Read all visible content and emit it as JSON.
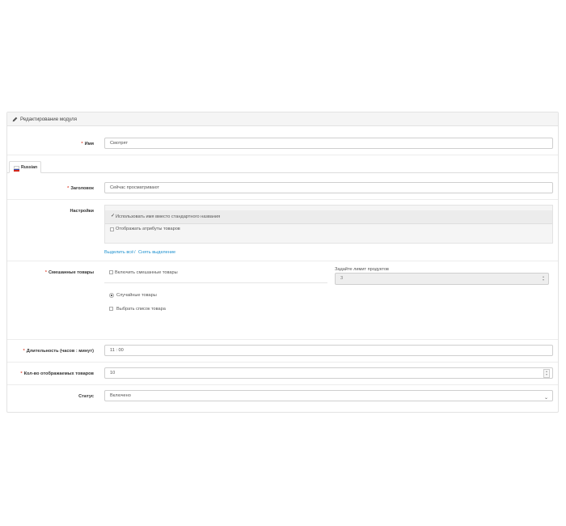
{
  "panel": {
    "title": "Редактирование модуля"
  },
  "fields": {
    "name": {
      "label": "Имя",
      "value": "Смотрят"
    },
    "language_tab": {
      "label": "Russian"
    },
    "heading": {
      "label": "Заголовок",
      "value": "Сейчас просматривают"
    },
    "settings": {
      "label": "Настройки",
      "options": [
        {
          "label": "Использовать имя вместо стандартного названия",
          "checked": true
        },
        {
          "label": "Отображать атрибуты товаров",
          "checked": false
        }
      ],
      "select_all": "Выделить всё",
      "separator": "/",
      "deselect": "Снять выделение"
    },
    "mixed": {
      "label": "Смешанные товары",
      "enable_label": "Включить смешанные товары",
      "limit_label": "Задайте лимит продуктов",
      "limit_value": "3",
      "radio_random": "Случайные товары",
      "radio_list": "Выбрать список товара"
    },
    "duration": {
      "label": "Длительность (часов : минут)",
      "value": "11 : 00"
    },
    "count": {
      "label": "Кол-во отображаемых товаров",
      "value": "10"
    },
    "status": {
      "label": "Статус",
      "value": "Включено"
    }
  },
  "colors": {
    "required": "#e3503e",
    "link": "#1e91cf"
  },
  "icons": [
    "pencil-icon",
    "russian-flag-icon",
    "chevron-down-icon",
    "spinner-icon"
  ]
}
